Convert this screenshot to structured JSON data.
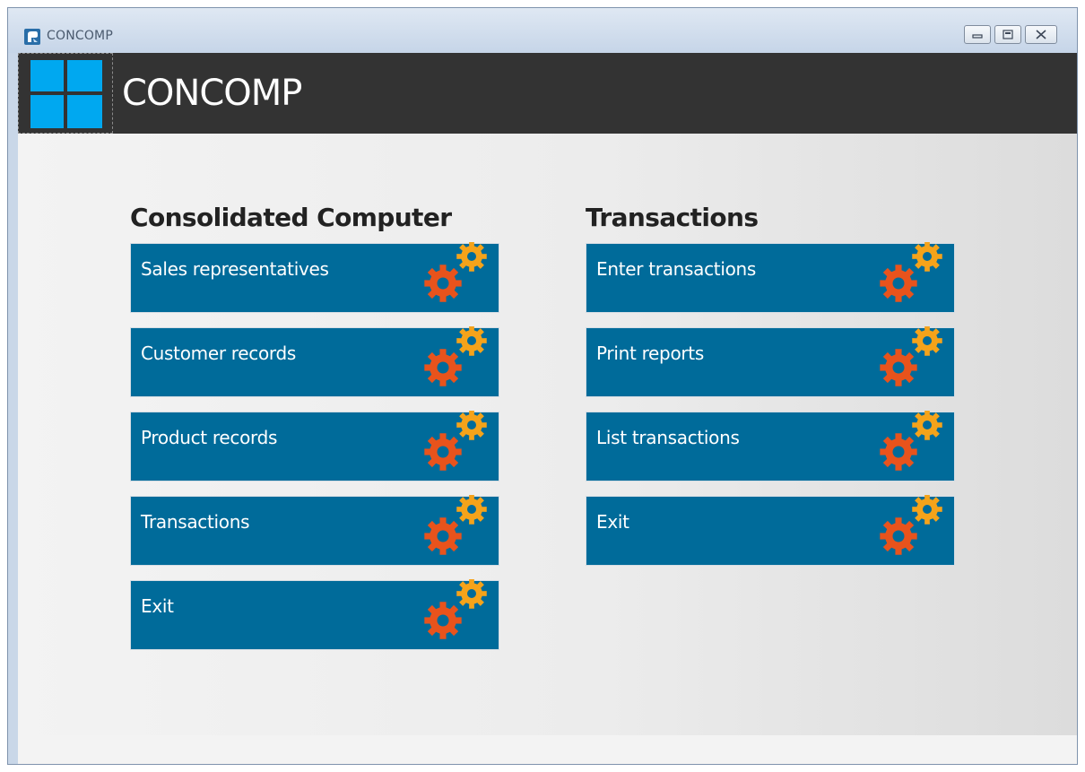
{
  "window": {
    "title": "CONCOMP",
    "controls": [
      "minimize",
      "maximize",
      "close"
    ]
  },
  "header": {
    "logo_icon": "windows-logo-icon",
    "title": "CONCOMP"
  },
  "sections": [
    {
      "title": "Consolidated Computer",
      "tiles": [
        {
          "label": "Sales representatives",
          "icon": "gears-icon"
        },
        {
          "label": "Customer records",
          "icon": "gears-icon"
        },
        {
          "label": "Product records",
          "icon": "gears-icon"
        },
        {
          "label": "Transactions",
          "icon": "gears-icon"
        },
        {
          "label": "Exit",
          "icon": "gears-icon"
        }
      ]
    },
    {
      "title": "Transactions",
      "tiles": [
        {
          "label": "Enter transactions",
          "icon": "gears-icon"
        },
        {
          "label": "Print reports",
          "icon": "gears-icon"
        },
        {
          "label": "List transactions",
          "icon": "gears-icon"
        },
        {
          "label": "Exit",
          "icon": "gears-icon"
        }
      ]
    }
  ],
  "colors": {
    "header_bg": "#333333",
    "tile_bg": "#006b9a",
    "logo_blue": "#00a8f0",
    "gear_orange": "#e8531c",
    "gear_yellow": "#f5a31a"
  }
}
